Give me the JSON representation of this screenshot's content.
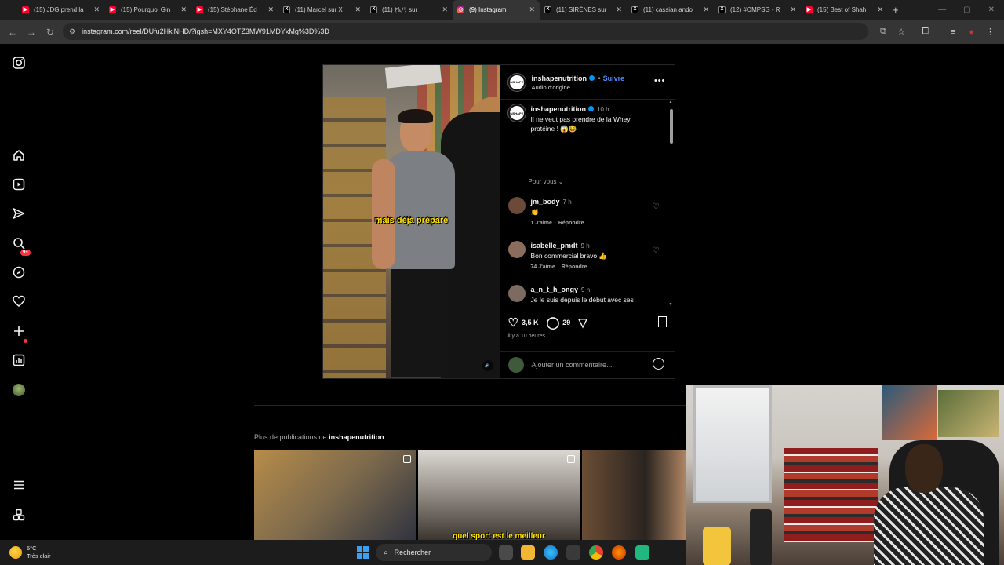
{
  "browser": {
    "tabs": [
      {
        "label": "(15) JDG prend la",
        "fav": "yt"
      },
      {
        "label": "(15) Pourquoi Gin",
        "fav": "yt"
      },
      {
        "label": "(15) Stéphane Éd",
        "fav": "yt"
      },
      {
        "label": "(11) Marcel sur X",
        "fav": "x"
      },
      {
        "label": "(11) ﾔﾑﾉﾘ sur",
        "fav": "x"
      },
      {
        "label": "(9) Instagram",
        "fav": "ig",
        "active": true
      },
      {
        "label": "(11) SIRÈNES sur",
        "fav": "x"
      },
      {
        "label": "(11) cassian ando",
        "fav": "x"
      },
      {
        "label": "(12) #OMPSG - R",
        "fav": "x"
      },
      {
        "label": "(15) Best of Shah",
        "fav": "yt"
      }
    ],
    "new_tab": "+",
    "url": "instagram.com/reel/DUfu2HkjNHD/?igsh=MXY4OTZ3MW91MDYxMg%3D%3D"
  },
  "sidebar": {
    "notifications_badge": "9+",
    "items": [
      "instagram-logo",
      "home",
      "reels",
      "messages",
      "search",
      "explore",
      "notifications",
      "create",
      "dashboard",
      "profile",
      "menu",
      "threads"
    ]
  },
  "post": {
    "caption_overlay": "mais déjà préparé",
    "author": {
      "username": "inshapenutrition",
      "follow": "Suivre",
      "audio": "Audio d'origine",
      "avatar_text": "INSHAPE"
    },
    "description": {
      "username": "inshapenutrition",
      "time": "10 h",
      "text": "Il ne veut pas prendre de la Whey protéine ! 😱😂"
    },
    "for_you": "Pour vous",
    "comments": [
      {
        "username": "jm_body",
        "time": "7 h",
        "text": "👏",
        "likes": "1 J'aime",
        "reply": "Répondre",
        "color": "#6b4a3a"
      },
      {
        "username": "isabelle_pmdt",
        "time": "9 h",
        "text": "Bon commercial bravo 👍",
        "likes": "74 J'aime",
        "reply": "Répondre",
        "color": "#8a6d5c"
      },
      {
        "username": "a_n_t_h_ongy",
        "time": "9 h",
        "text": "Je le suis depuis le début avec ses boîtes à œufs dans sa chambre et son légendaire : DAMMMMM les gens, j'ai eu une période d'un peu moins, et la",
        "color": "#7d6a60"
      }
    ],
    "likes": "3,5 K",
    "comments_count": "29",
    "time_ago": "il y a 10 heures",
    "add_comment_placeholder": "Ajouter un commentaire..."
  },
  "more_posts": {
    "label": "Plus de publications de",
    "username": "inshapenutrition",
    "thumb_caption": "quel sport est le meilleur"
  },
  "taskbar": {
    "temp": "5°C",
    "weather": "Très clair",
    "search": "Rechercher"
  }
}
